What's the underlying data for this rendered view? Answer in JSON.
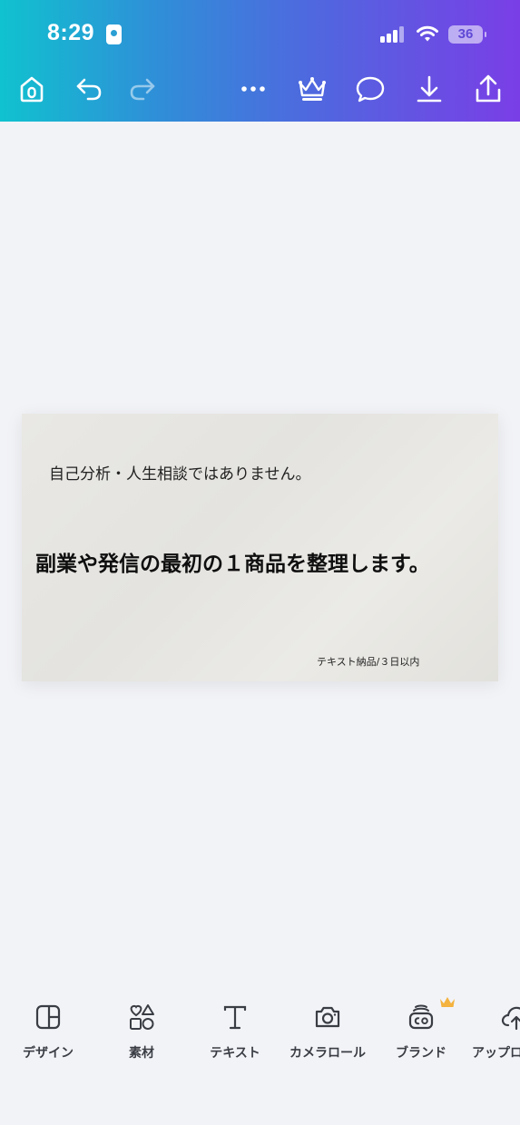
{
  "status_bar": {
    "time": "8:29",
    "battery_level": "36",
    "icons": [
      "id-card-icon",
      "signal-icon",
      "wifi-icon",
      "battery-icon"
    ]
  },
  "toolbar": {
    "icons": [
      "home-icon",
      "undo-icon",
      "redo-icon",
      "more-icon",
      "crown-icon",
      "comment-icon",
      "download-icon",
      "share-icon"
    ]
  },
  "design": {
    "subtitle": "自己分析・人生相談ではありません。",
    "headline": "副業や発信の最初の１商品を整理します。",
    "footnote": "テキスト納品/３日以内"
  },
  "bottom_nav": {
    "items": [
      {
        "label": "デザイン",
        "icon": "design-layout-icon"
      },
      {
        "label": "素材",
        "icon": "elements-icon"
      },
      {
        "label": "テキスト",
        "icon": "text-icon"
      },
      {
        "label": "カメラロール",
        "icon": "camera-icon"
      },
      {
        "label": "ブランド",
        "icon": "brand-icon"
      },
      {
        "label": "アップロ",
        "icon": "upload-cloud-icon"
      }
    ]
  },
  "colors": {
    "gradient_start": "#10c2cf",
    "gradient_end": "#7a3ee6",
    "premium_crown": "#f4b23e"
  }
}
